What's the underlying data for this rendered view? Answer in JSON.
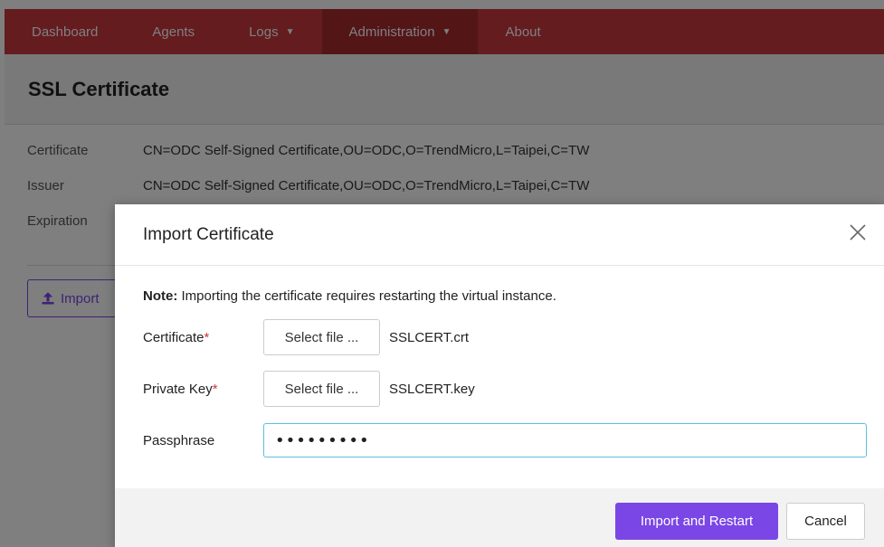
{
  "navbar": {
    "items": [
      {
        "label": "Dashboard"
      },
      {
        "label": "Agents"
      },
      {
        "label": "Logs"
      },
      {
        "label": "Administration"
      },
      {
        "label": "About"
      }
    ]
  },
  "page": {
    "title": "SSL Certificate",
    "info": [
      {
        "label": "Certificate",
        "value": "CN=ODC Self-Signed Certificate,OU=ODC,O=TrendMicro,L=Taipei,C=TW"
      },
      {
        "label": "Issuer",
        "value": "CN=ODC Self-Signed Certificate,OU=ODC,O=TrendMicro,L=Taipei,C=TW"
      },
      {
        "label": "Expiration",
        "value": ""
      }
    ],
    "import_button": "Import"
  },
  "modal": {
    "title": "Import Certificate",
    "note_prefix": "Note:",
    "note_text": " Importing the certificate requires restarting the virtual instance.",
    "certificate": {
      "label": "Certificate",
      "required": "*",
      "button": "Select file ...",
      "filename": "SSLCERT.crt"
    },
    "private_key": {
      "label": "Private Key",
      "required": "*",
      "button": "Select file ...",
      "filename": "SSLCERT.key"
    },
    "passphrase": {
      "label": "Passphrase",
      "value": "•••••••••"
    },
    "import_restart": "Import and Restart",
    "cancel": "Cancel"
  },
  "colors": {
    "brand": "#c9393d",
    "accent": "#7b46e6",
    "focus": "#5bc0de"
  }
}
